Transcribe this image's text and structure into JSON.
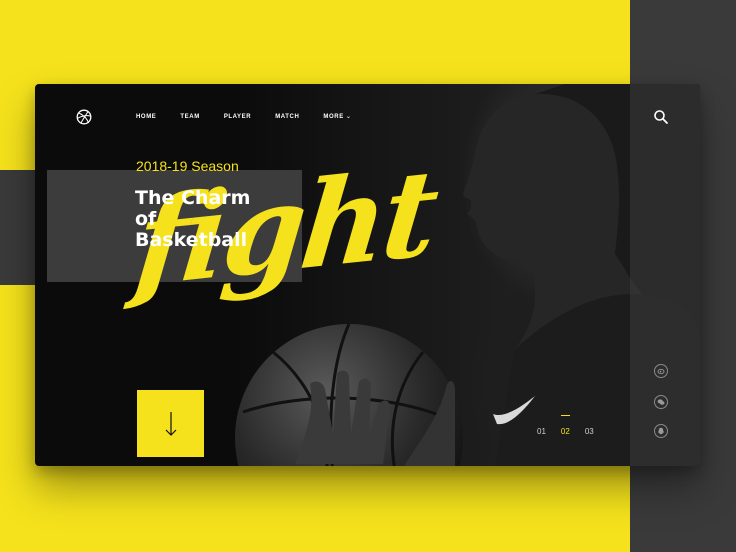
{
  "nav": {
    "items": [
      {
        "label": "HOME"
      },
      {
        "label": "TEAM"
      },
      {
        "label": "PLAYER"
      },
      {
        "label": "MATCH"
      },
      {
        "label": "MORE"
      }
    ]
  },
  "hero": {
    "season": "2018-19 Season",
    "title_lines": [
      "The Charm",
      "of",
      "Basketball"
    ],
    "script_word": "fight"
  },
  "pager": {
    "pages": [
      "01",
      "02",
      "03"
    ],
    "active": "02"
  },
  "icons": {
    "logo": "dribbble-ball-icon",
    "search": "search-icon",
    "scroll": "arrow-down-icon",
    "social": [
      "weibo-icon",
      "wechat-icon",
      "qq-icon"
    ]
  },
  "colors": {
    "accent": "#f5e21c",
    "window_bg": "#0b0b0c",
    "backdrop_dark": "#3a3a3a"
  }
}
